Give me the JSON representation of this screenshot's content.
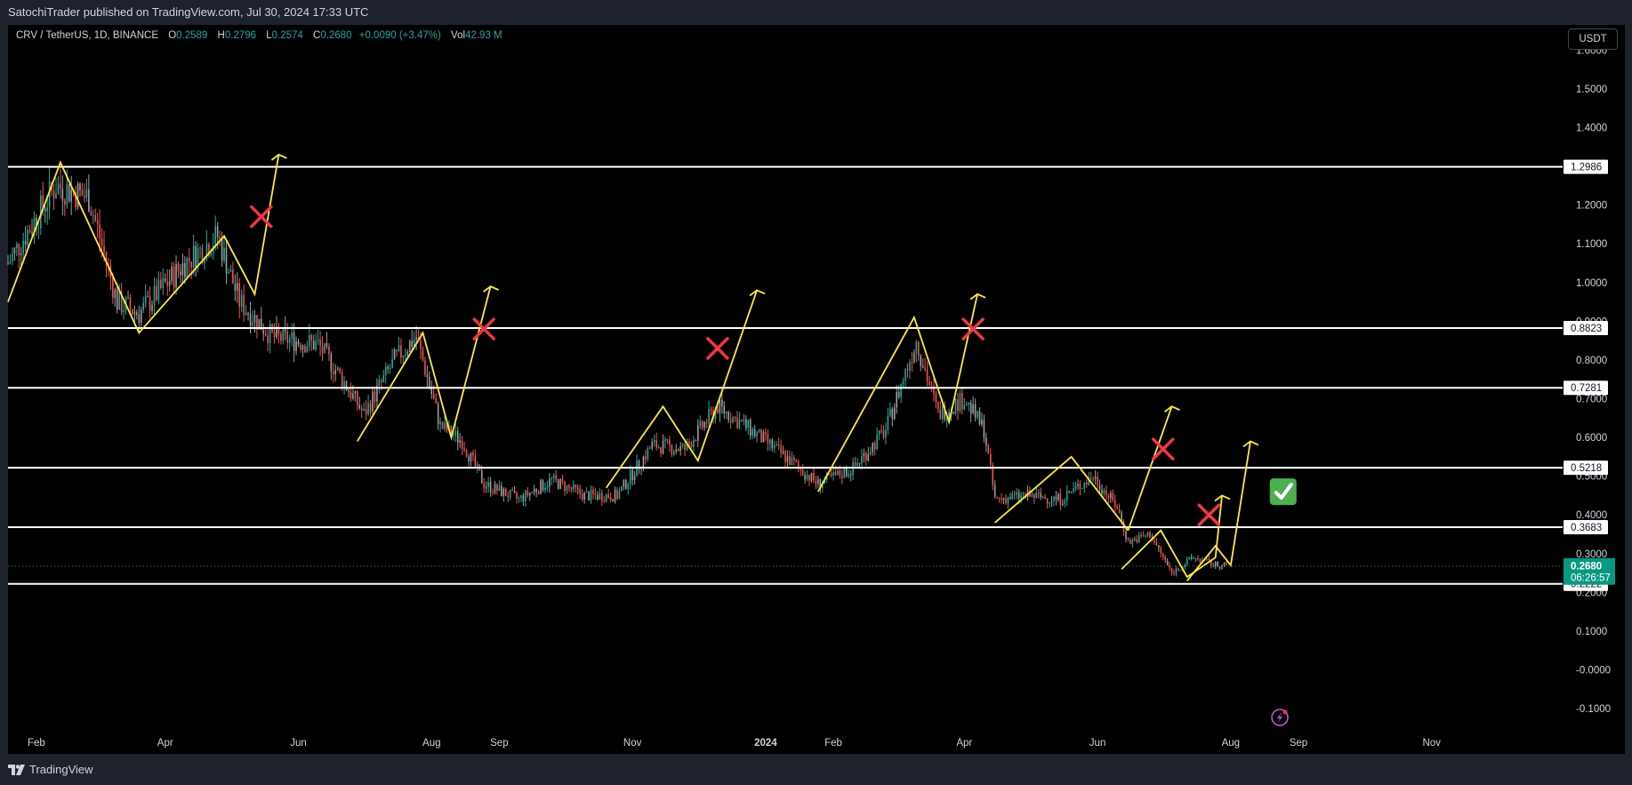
{
  "header": {
    "published_text": "SatochiTrader published on TradingView.com, Jul 30, 2024 17:33 UTC"
  },
  "legend": {
    "symbol": "CRV / TetherUS, 1D, BINANCE",
    "o_label": "O",
    "o_value": "0.2589",
    "h_label": "H",
    "h_value": "0.2796",
    "l_label": "L",
    "l_value": "0.2574",
    "c_label": "C",
    "c_value": "0.2680",
    "change": "+0.0090 (+3.47%)",
    "vol_label": "Vol",
    "vol_value": "42.93 M"
  },
  "currency": "USDT",
  "footer": {
    "brand": "TradingView"
  },
  "colors": {
    "up": "#26a69a",
    "down": "#ef5350",
    "candle_neutral": "#9e9e9e",
    "level_line": "#ffffff",
    "path": "#ffeb3b",
    "cross": "#f23645",
    "check_bg": "#4caf50",
    "price_badge": "#089981"
  },
  "chart_data": {
    "type": "candlestick",
    "symbol": "CRV / TetherUS",
    "interval": "1D",
    "exchange": "BINANCE",
    "x_ticks": [
      "Feb",
      "Apr",
      "Jun",
      "Aug",
      "Sep",
      "Nov",
      "2024",
      "Feb",
      "Apr",
      "Jun",
      "Aug",
      "Sep",
      "Nov"
    ],
    "x_tick_dates": [
      "2023-02-01",
      "2023-04-01",
      "2023-06-01",
      "2023-08-01",
      "2023-09-01",
      "2023-11-01",
      "2024-01-01",
      "2024-02-01",
      "2024-04-01",
      "2024-06-01",
      "2024-08-01",
      "2024-09-01",
      "2024-11-01"
    ],
    "x_range": [
      "2023-01-19",
      "2024-12-31"
    ],
    "y_ticks": [
      "1.6000",
      "1.5000",
      "1.4000",
      "1.3000",
      "1.2000",
      "1.1000",
      "1.0000",
      "0.9000",
      "0.8000",
      "0.7000",
      "0.6000",
      "0.5000",
      "0.4000",
      "0.3000",
      "0.2000",
      "0.1000",
      "-0.0000",
      "-0.1000"
    ],
    "y_tick_values": [
      1.6,
      1.5,
      1.4,
      1.3,
      1.2,
      1.1,
      1.0,
      0.9,
      0.8,
      0.7,
      0.6,
      0.5,
      0.4,
      0.3,
      0.2,
      0.1,
      0.0,
      -0.1
    ],
    "ylim": [
      -0.148,
      1.665
    ],
    "horizontal_levels": [
      {
        "value": 1.2986,
        "label": "1.2986"
      },
      {
        "value": 0.8823,
        "label": "0.8823"
      },
      {
        "value": 0.7281,
        "label": "0.7281"
      },
      {
        "value": 0.5218,
        "label": "0.5218"
      },
      {
        "value": 0.3683,
        "label": "0.3683"
      },
      {
        "value": 0.2222,
        "label": "0.2222"
      }
    ],
    "last_price": {
      "value": 0.268,
      "label": "0.2680",
      "countdown": "06:26:57"
    },
    "price_path_anchors": [
      [
        "2023-01-19",
        1.05
      ],
      [
        "2023-02-10",
        1.25
      ],
      [
        "2023-02-25",
        1.22
      ],
      [
        "2023-03-10",
        0.95
      ],
      [
        "2023-03-20",
        0.92
      ],
      [
        "2023-04-10",
        1.05
      ],
      [
        "2023-04-25",
        1.12
      ],
      [
        "2023-05-05",
        0.95
      ],
      [
        "2023-05-20",
        0.86
      ],
      [
        "2023-06-10",
        0.84
      ],
      [
        "2023-06-20",
        0.76
      ],
      [
        "2023-07-01",
        0.66
      ],
      [
        "2023-07-15",
        0.8
      ],
      [
        "2023-07-25",
        0.86
      ],
      [
        "2023-08-05",
        0.63
      ],
      [
        "2023-08-15",
        0.59
      ],
      [
        "2023-08-25",
        0.48
      ],
      [
        "2023-09-10",
        0.44
      ],
      [
        "2023-09-25",
        0.49
      ],
      [
        "2023-10-10",
        0.45
      ],
      [
        "2023-10-25",
        0.45
      ],
      [
        "2023-11-10",
        0.58
      ],
      [
        "2023-11-25",
        0.57
      ],
      [
        "2023-12-10",
        0.68
      ],
      [
        "2023-12-25",
        0.62
      ],
      [
        "2024-01-10",
        0.55
      ],
      [
        "2024-01-25",
        0.48
      ],
      [
        "2024-02-10",
        0.52
      ],
      [
        "2024-02-25",
        0.62
      ],
      [
        "2024-03-10",
        0.85
      ],
      [
        "2024-03-20",
        0.66
      ],
      [
        "2024-04-01",
        0.7
      ],
      [
        "2024-04-10",
        0.62
      ],
      [
        "2024-04-15",
        0.44
      ],
      [
        "2024-04-30",
        0.45
      ],
      [
        "2024-05-15",
        0.44
      ],
      [
        "2024-05-30",
        0.5
      ],
      [
        "2024-06-10",
        0.42
      ],
      [
        "2024-06-15",
        0.33
      ],
      [
        "2024-06-25",
        0.35
      ],
      [
        "2024-07-05",
        0.25
      ],
      [
        "2024-07-15",
        0.29
      ],
      [
        "2024-07-25",
        0.27
      ],
      [
        "2024-07-30",
        0.268
      ]
    ],
    "drawings": {
      "zigzag_paths": [
        [
          [
            "2023-01-19",
            0.95
          ],
          [
            "2023-02-12",
            1.31
          ],
          [
            "2023-03-20",
            0.87
          ],
          [
            "2023-04-28",
            1.12
          ],
          [
            "2023-05-12",
            0.97
          ],
          [
            "2023-05-23",
            1.33
          ]
        ],
        [
          [
            "2023-06-28",
            0.59
          ],
          [
            "2023-07-28",
            0.87
          ],
          [
            "2023-08-10",
            0.6
          ],
          [
            "2023-08-28",
            0.99
          ]
        ],
        [
          [
            "2023-10-20",
            0.47
          ],
          [
            "2023-11-15",
            0.68
          ],
          [
            "2023-12-01",
            0.54
          ],
          [
            "2023-12-28",
            0.98
          ]
        ],
        [
          [
            "2024-01-25",
            0.46
          ],
          [
            "2024-03-09",
            0.91
          ],
          [
            "2024-03-25",
            0.64
          ],
          [
            "2024-04-07",
            0.97
          ]
        ],
        [
          [
            "2024-04-15",
            0.38
          ],
          [
            "2024-05-20",
            0.55
          ],
          [
            "2024-06-15",
            0.36
          ]
        ],
        [
          [
            "2024-06-12",
            0.26
          ],
          [
            "2024-06-30",
            0.36
          ],
          [
            "2024-07-12",
            0.24
          ],
          [
            "2024-07-25",
            0.29
          ],
          [
            "2024-07-28",
            0.45
          ]
        ],
        [
          [
            "2024-06-15",
            0.36
          ],
          [
            "2024-07-05",
            0.68
          ]
        ],
        [
          [
            "2024-07-12",
            0.23
          ],
          [
            "2024-07-25",
            0.32
          ],
          [
            "2024-08-01",
            0.27
          ],
          [
            "2024-08-10",
            0.59
          ]
        ]
      ],
      "arrow_tips": [
        [
          "2023-05-23",
          1.33
        ],
        [
          "2023-08-28",
          0.99
        ],
        [
          "2023-12-28",
          0.98
        ],
        [
          "2024-04-07",
          0.97
        ],
        [
          "2024-07-05",
          0.68
        ],
        [
          "2024-07-28",
          0.45
        ],
        [
          "2024-08-10",
          0.59
        ]
      ],
      "red_crosses": [
        [
          "2023-05-15",
          1.17
        ],
        [
          "2023-08-25",
          0.88
        ],
        [
          "2023-12-10",
          0.83
        ],
        [
          "2024-04-05",
          0.88
        ],
        [
          "2024-07-01",
          0.57
        ],
        [
          "2024-07-22",
          0.4
        ]
      ],
      "check_mark": [
        "2024-08-25",
        0.46
      ]
    }
  }
}
